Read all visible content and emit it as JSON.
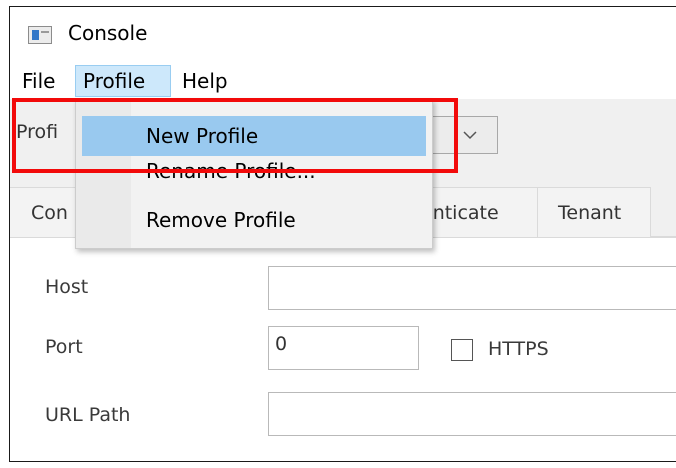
{
  "window": {
    "title": "Console"
  },
  "menubar": {
    "file": "File",
    "profile": "Profile",
    "help": "Help"
  },
  "profile_bar": {
    "label": "Profi"
  },
  "profile_menu": {
    "new_profile": "New Profile",
    "rename_profile": "Rename Profile...",
    "remove_profile": "Remove Profile"
  },
  "tabs": {
    "first": "Con",
    "authenticate": "enticate",
    "tenant": "Tenant"
  },
  "form": {
    "host_label": "Host",
    "host_value": "",
    "port_label": "Port",
    "port_value": "0",
    "https_label": "HTTPS",
    "https_checked": false,
    "url_path_label": "URL Path",
    "url_path_value": ""
  },
  "annotation": {
    "highlight_color": "#f20a0a"
  },
  "colors": {
    "menu_selected": "#99c9ef",
    "menu_hover": "#cde8fb"
  }
}
